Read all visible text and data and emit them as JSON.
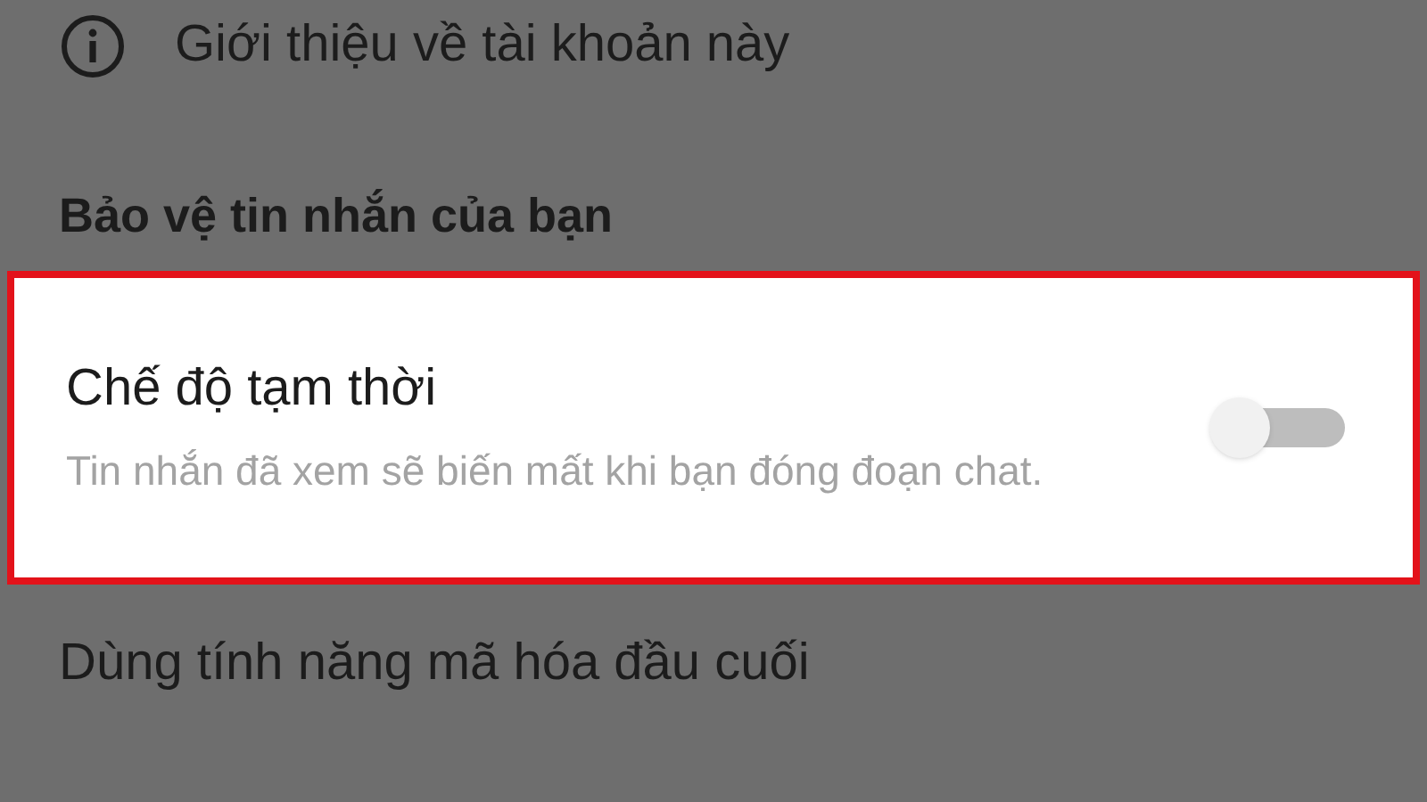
{
  "about_row": {
    "label": "Giới thiệu về tài khoản này"
  },
  "section_header": "Bảo vệ tin nhắn của bạn",
  "setting": {
    "title": "Chế độ tạm thời",
    "description": "Tin nhắn đã xem sẽ biến mất khi bạn đóng đoạn chat.",
    "on": false,
    "highlighted": true
  },
  "encryption_row": {
    "label": "Dùng tính năng mã hóa đầu cuối"
  }
}
